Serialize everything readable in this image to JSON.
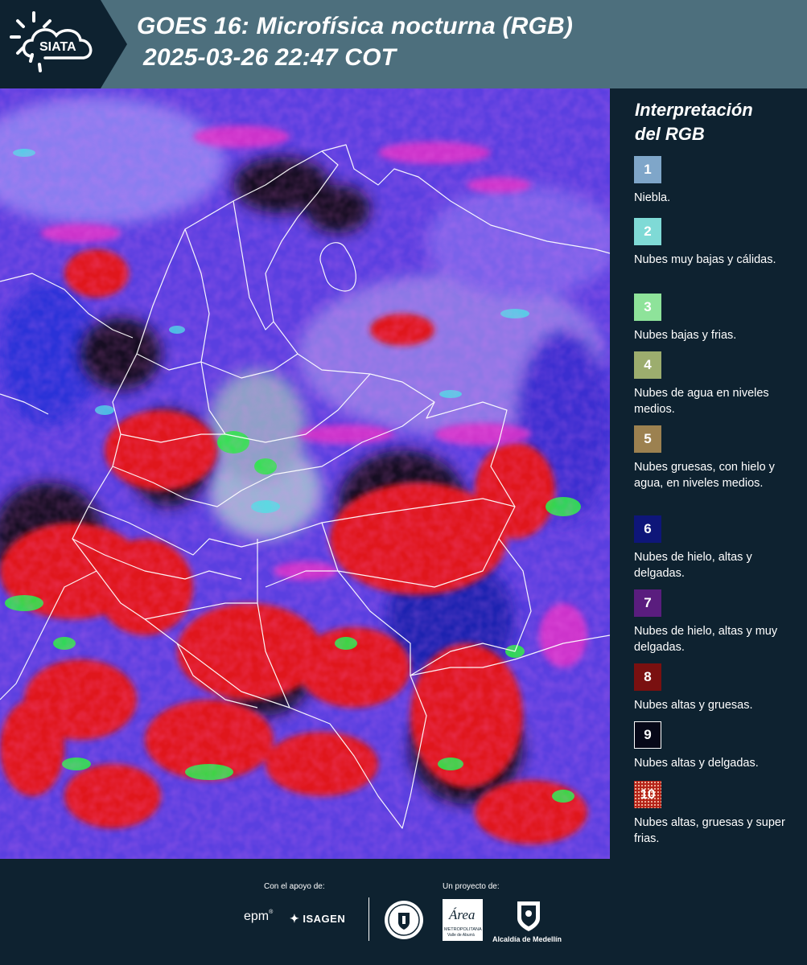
{
  "header": {
    "logo_text": "SIATA",
    "title_line1": "GOES 16: Microfísica nocturna (RGB)",
    "title_line2": "2025-03-26 22:47 COT"
  },
  "legend": {
    "title_line1": "Interpretación",
    "title_line2": "del RGB",
    "items": [
      {
        "number": "1",
        "color": "#7fa6c9",
        "label": "Niebla."
      },
      {
        "number": "2",
        "color": "#7fdad6",
        "label": "Nubes muy bajas y cálidas."
      },
      {
        "number": "3",
        "color": "#8ee39a",
        "label": "Nubes bajas y frias."
      },
      {
        "number": "4",
        "color": "#9cad6e",
        "label": "Nubes de agua en niveles medios."
      },
      {
        "number": "5",
        "color": "#9c8150",
        "label": "Nubes gruesas, con hielo y agua, en niveles medios."
      },
      {
        "number": "6",
        "color": "#0e1679",
        "label": "Nubes de hielo, altas y delgadas."
      },
      {
        "number": "7",
        "color": "#5a1d7e",
        "label": "Nubes de hielo, altas y muy delgadas."
      },
      {
        "number": "8",
        "color": "#7a1010",
        "label": "Nubes altas y gruesas."
      },
      {
        "number": "9",
        "color": "#060818",
        "label": "Nubes altas y delgadas."
      },
      {
        "number": "10",
        "color": "#b52318",
        "label": "Nubes altas, gruesas y super frias."
      }
    ]
  },
  "footer": {
    "support_label": "Con el apoyo de:",
    "project_label": "Un proyecto de:",
    "sponsor_epm": "epm",
    "sponsor_isagen": "ISAGEN",
    "partner_area": "Área",
    "partner_area_sub": "METROPOLITANA",
    "partner_area_sub2": "Valle de Aburrá",
    "partner_alcaldia": "Alcaldía de Medellín"
  },
  "colors": {
    "header_bg": "#4d6f7d",
    "logo_bg": "#0e2230",
    "page_bg": "#0e2230",
    "map_violet": "#5a3fe0",
    "map_red": "#e0141c",
    "map_magenta": "#e033c8",
    "map_green": "#2ee84a"
  }
}
